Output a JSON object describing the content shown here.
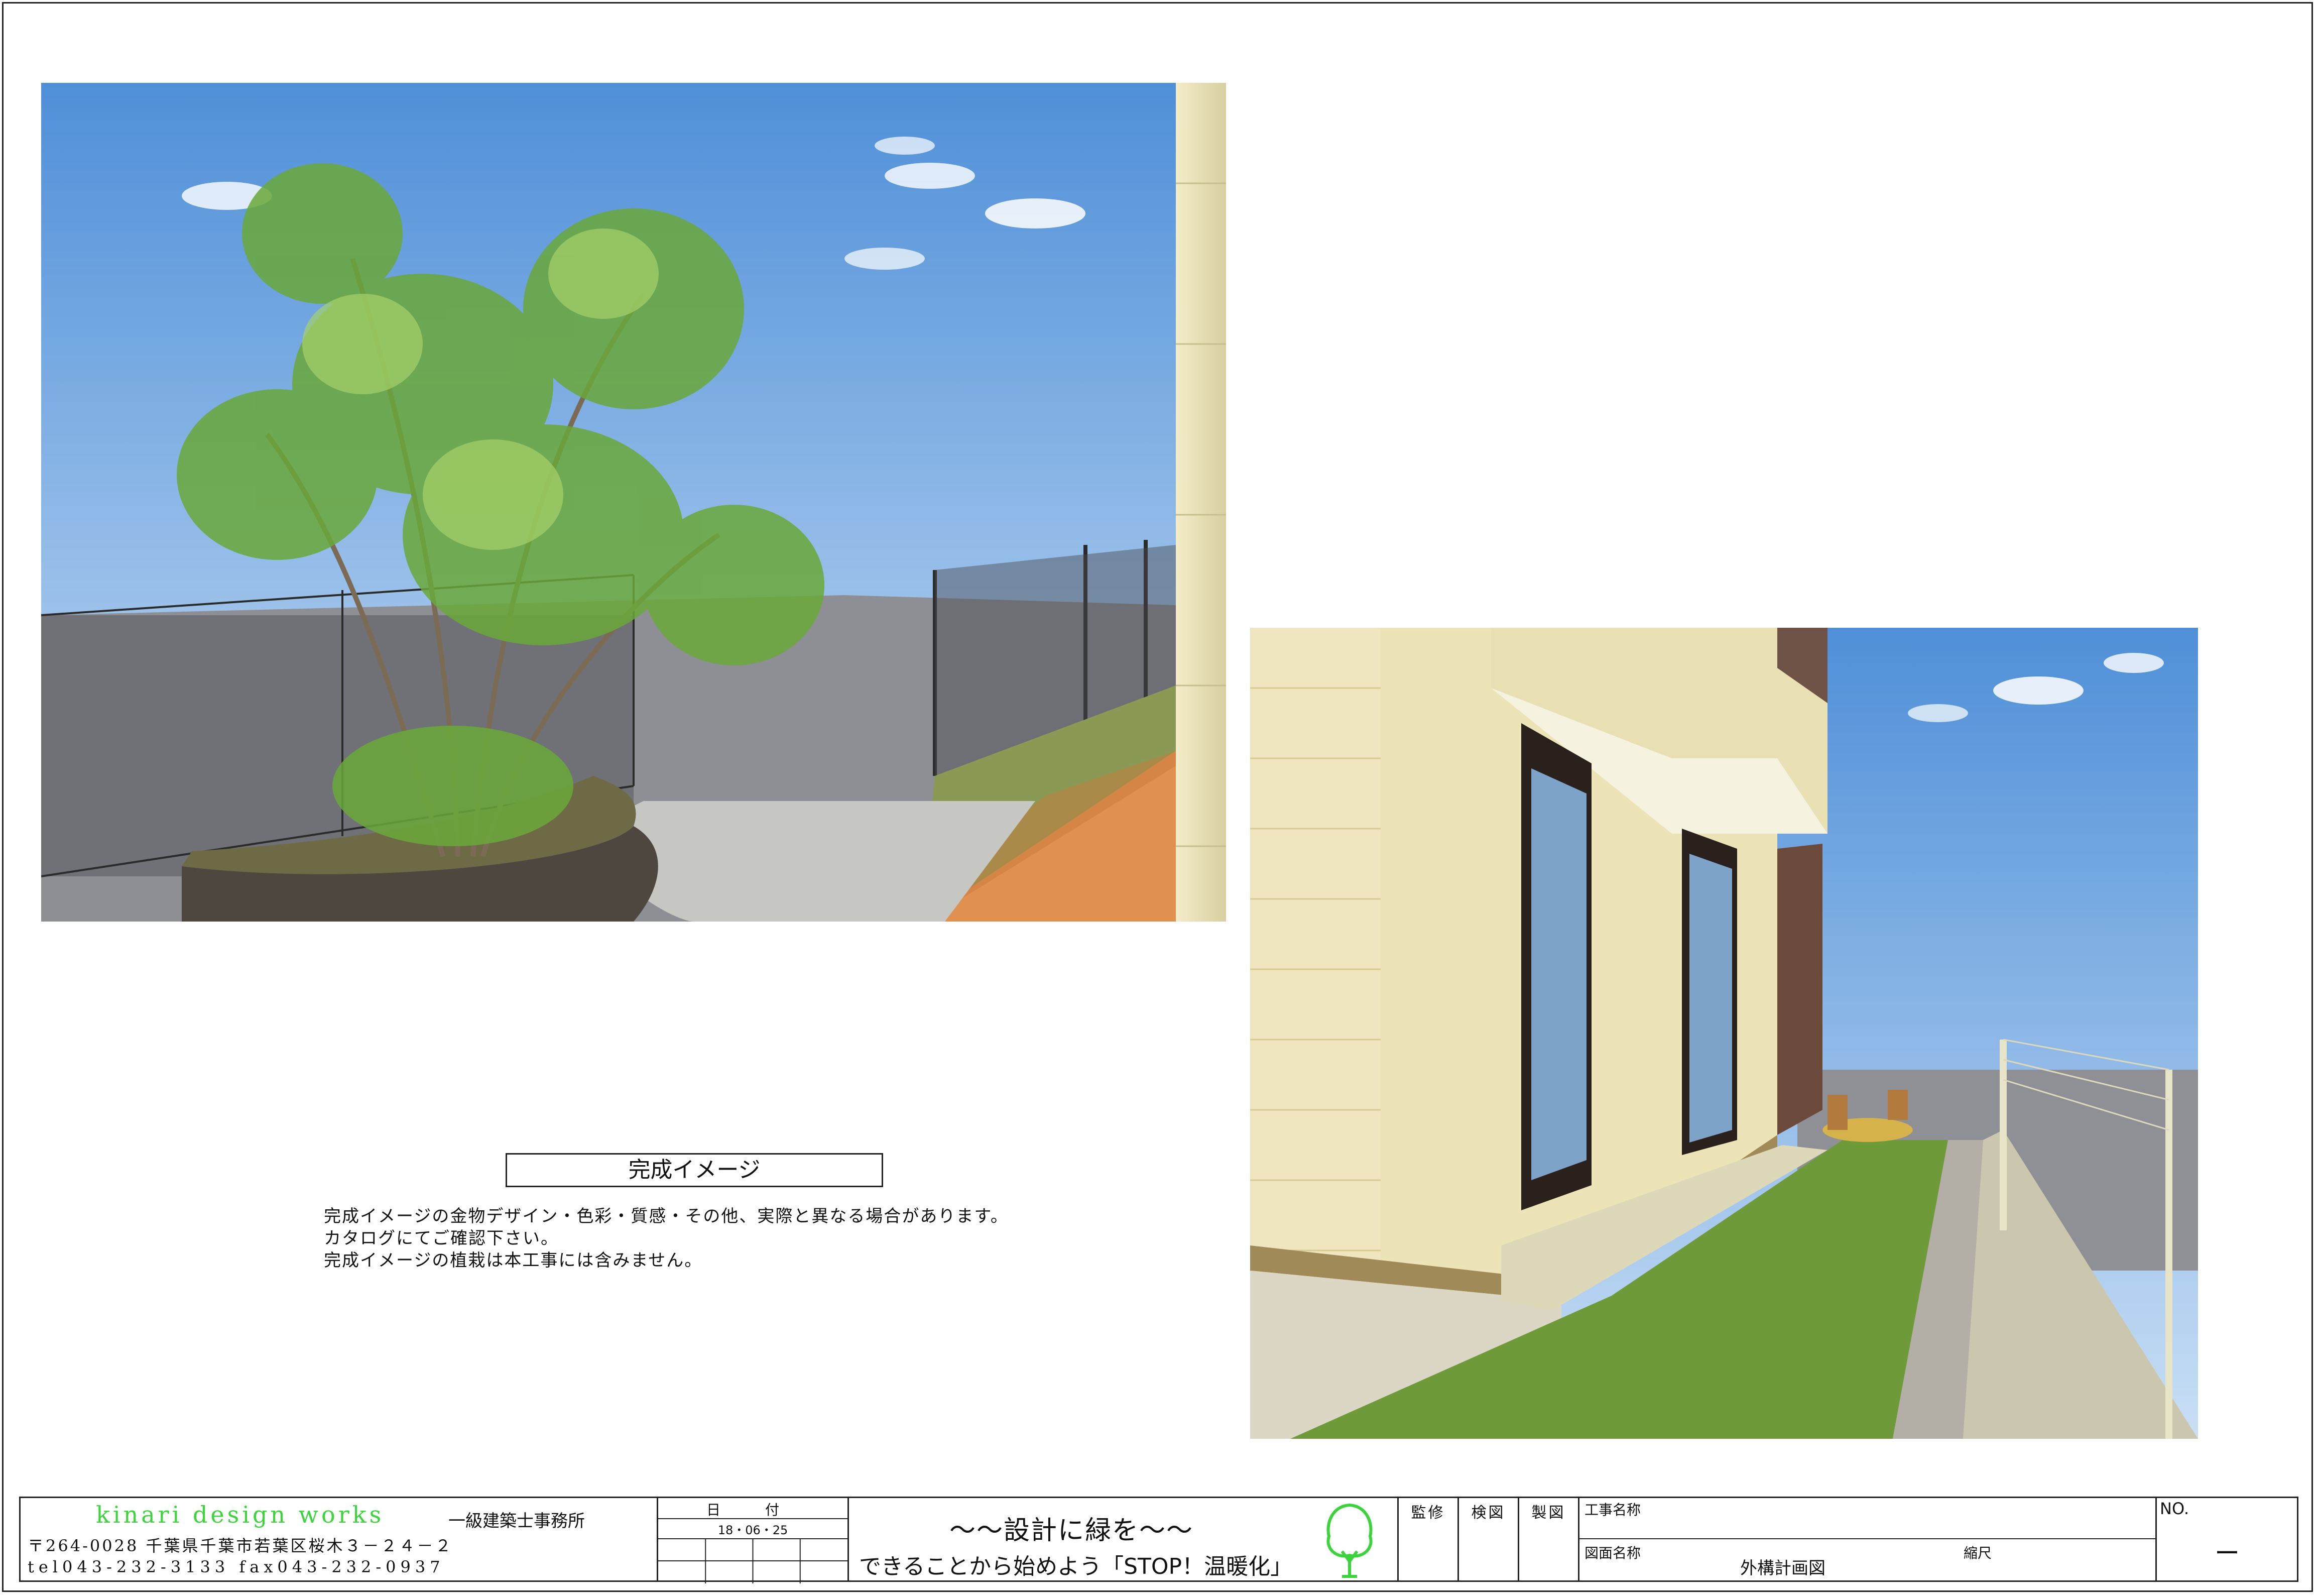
{
  "caption": {
    "title": "完成イメージ"
  },
  "notes": [
    "完成イメージの金物デザイン・色彩・質感・その他、実際と異なる場合があります。",
    "カタログにてご確認下さい。",
    "完成イメージの植栽は本工事には含みません。"
  ],
  "titleblock": {
    "firm_name": "kinari design works",
    "firm_type": "一級建築士事務所",
    "address": "〒264-0028 千葉県千葉市若葉区桜木３－２４－２",
    "tel_fax": "tel043-232-3133   fax043-232-0937",
    "date_label": "日 付",
    "date_value": "18・06・25",
    "slogan_1": "〜〜設計に緑を〜〜",
    "slogan_2": "できることから始めよう「STOP！温暖化」",
    "sig_supervision": "監修",
    "sig_check": "検図",
    "sig_draft": "製図",
    "project_label": "工事名称",
    "project_value": "",
    "drawing_label": "図面名称",
    "drawing_value": "外構計画図",
    "scale_label": "縮尺",
    "no_label": "NO.",
    "no_value": "ー"
  },
  "colors": {
    "brand_green": "#3bd43b",
    "sky": "#5f9de0",
    "lawn": "#6f9a3a",
    "tile": "#e0914f"
  }
}
